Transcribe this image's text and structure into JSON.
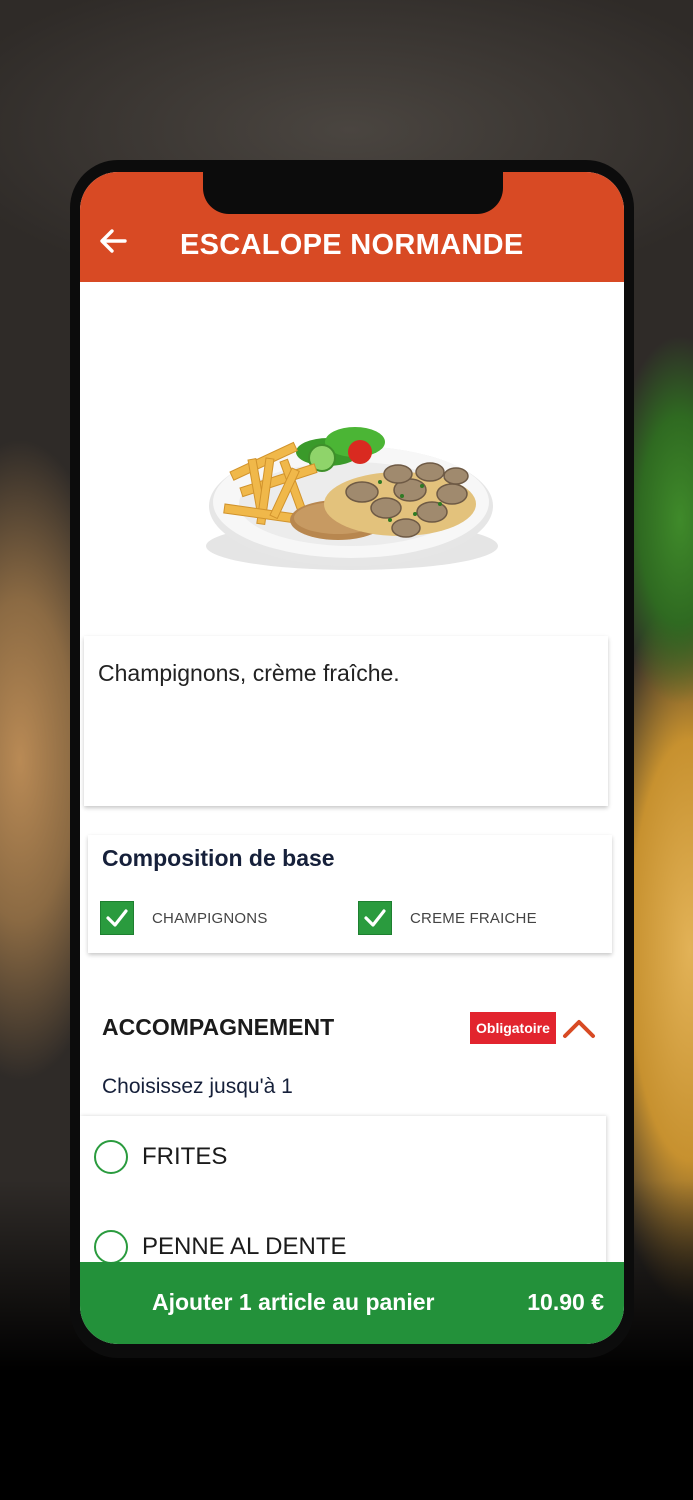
{
  "header": {
    "title": "ESCALOPE NORMANDE"
  },
  "product": {
    "description": "Champignons, crème fraîche."
  },
  "composition": {
    "title": "Composition de base",
    "items": [
      {
        "label": "CHAMPIGNONS",
        "checked": true
      },
      {
        "label": "CREME FRAICHE",
        "checked": true
      }
    ]
  },
  "accompagnement": {
    "title": "ACCOMPAGNEMENT",
    "badge": "Obligatoire",
    "subtitle": "Choisissez jusqu'à 1",
    "options": [
      {
        "label": "FRITES",
        "selected": false
      },
      {
        "label": "PENNE AL DENTE",
        "selected": false
      }
    ]
  },
  "cart": {
    "label": "Ajouter 1 article au panier",
    "price": "10.90 €"
  },
  "colors": {
    "header": "#d84a24",
    "accent_green": "#23913a",
    "badge_red": "#e2242e"
  }
}
